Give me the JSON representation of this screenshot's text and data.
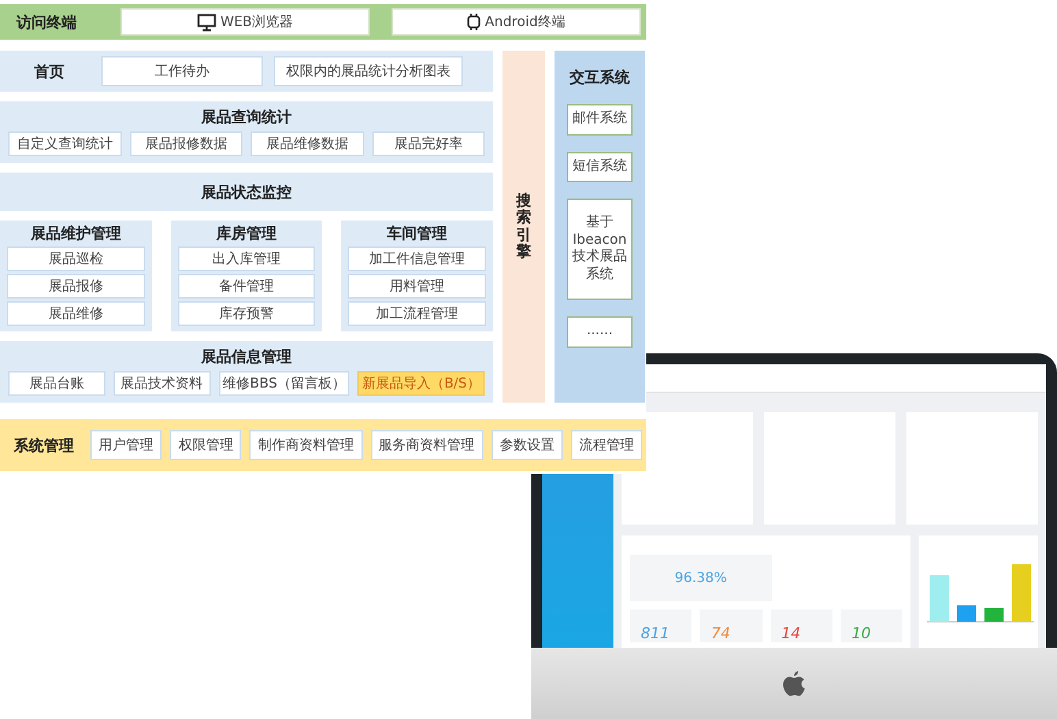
{
  "access_bar": {
    "title": "访问终端",
    "terminals": [
      {
        "label": "WEB浏览器",
        "kind": "monitor"
      },
      {
        "label": "Android终端",
        "kind": "android"
      }
    ]
  },
  "home": {
    "title": "首页",
    "items": [
      "工作待办",
      "权限内的展品统计分析图表"
    ]
  },
  "query_stats": {
    "title": "展品查询统计",
    "items": [
      "自定义查询统计",
      "展品报修数据",
      "展品维修数据",
      "展品完好率"
    ]
  },
  "status_monitor": {
    "title": "展品状态监控"
  },
  "groups": [
    {
      "title": "展品维护管理",
      "items": [
        "展品巡检",
        "展品报修",
        "展品维修"
      ]
    },
    {
      "title": "库房管理",
      "items": [
        "出入库管理",
        "备件管理",
        "库存预警"
      ]
    },
    {
      "title": "车间管理",
      "items": [
        "加工件信息管理",
        "用料管理",
        "加工流程管理"
      ]
    }
  ],
  "info_management": {
    "title": "展品信息管理",
    "items": [
      {
        "label": "展品台账",
        "highlighted": false
      },
      {
        "label": "展品技术资料",
        "highlighted": false
      },
      {
        "label": "维修BBS（留言板）",
        "highlighted": false
      },
      {
        "label": "新展品导入（B/S）",
        "highlighted": true
      }
    ]
  },
  "search_engine": {
    "title": "搜索引擎"
  },
  "interaction": {
    "title": "交互系统",
    "items": [
      "邮件系统",
      "短信系统",
      "基于Ibeacon技术展品系统",
      "......"
    ]
  },
  "system_management": {
    "title": "系统管理",
    "items": [
      "用户管理",
      "权限管理",
      "制作商资料管理",
      "服务商资料管理",
      "参数设置",
      "流程管理"
    ]
  },
  "monitor_screen": {
    "rate": "96.38%",
    "stats": [
      {
        "value": "811",
        "color": "#4ba3e3"
      },
      {
        "value": "74",
        "color": "#f08a3c"
      },
      {
        "value": "14",
        "color": "#e8443a"
      },
      {
        "value": "10",
        "color": "#3aa845"
      }
    ]
  }
}
